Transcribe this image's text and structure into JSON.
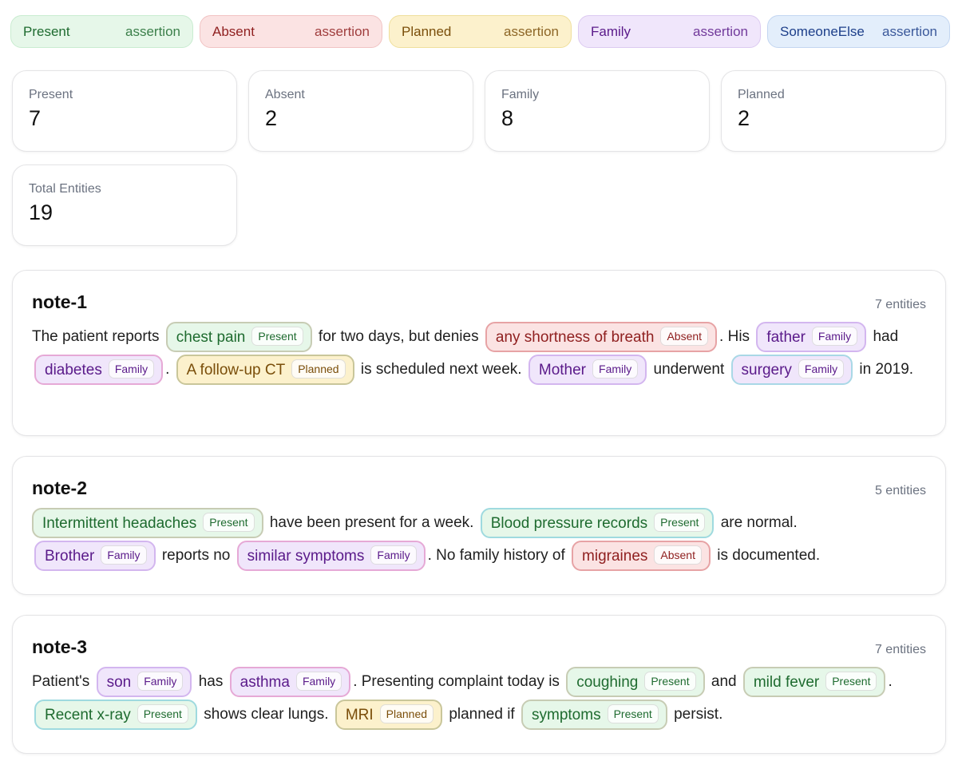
{
  "legend": [
    {
      "name": "Present",
      "tag": "assertion"
    },
    {
      "name": "Absent",
      "tag": "assertion"
    },
    {
      "name": "Planned",
      "tag": "assertion"
    },
    {
      "name": "Family",
      "tag": "assertion"
    },
    {
      "name": "SomeoneElse",
      "tag": "assertion"
    }
  ],
  "stats": {
    "present": {
      "label": "Present",
      "value": "7"
    },
    "absent": {
      "label": "Absent",
      "value": "2"
    },
    "family": {
      "label": "Family",
      "value": "8"
    },
    "planned": {
      "label": "Planned",
      "value": "2"
    },
    "total": {
      "label": "Total Entities",
      "value": "19"
    }
  },
  "notes": [
    {
      "title": "note-1",
      "count": "7 entities",
      "t": {
        "t0": "The patient reports",
        "t1": "for two days, but denies",
        "t2": ". His",
        "t3": "had",
        "t4": ".",
        "t5": "is scheduled next week.",
        "t6": "underwent",
        "t7": "in 2019."
      },
      "e": {
        "chest_pain": {
          "text": "chest pain",
          "tag": "Present"
        },
        "sob": {
          "text": "any shortness of breath",
          "tag": "Absent"
        },
        "father": {
          "text": "father",
          "tag": "Family"
        },
        "diabetes": {
          "text": "diabetes",
          "tag": "Family"
        },
        "followup": {
          "text": "A follow-up CT",
          "tag": "Planned"
        },
        "mother": {
          "text": "Mother",
          "tag": "Family"
        },
        "surgery": {
          "text": "surgery",
          "tag": "Family"
        }
      }
    },
    {
      "title": "note-2",
      "count": "5 entities",
      "t": {
        "t0": "have been present for a week.",
        "t1": "are normal.",
        "t2": "reports no",
        "t3": ". No family history of",
        "t4": "is documented."
      },
      "e": {
        "headaches": {
          "text": "Intermittent headaches",
          "tag": "Present"
        },
        "bp": {
          "text": "Blood pressure records",
          "tag": "Present"
        },
        "brother": {
          "text": "Brother",
          "tag": "Family"
        },
        "similar": {
          "text": "similar symptoms",
          "tag": "Family"
        },
        "migraines": {
          "text": "migraines",
          "tag": "Absent"
        }
      }
    },
    {
      "title": "note-3",
      "count": "7 entities",
      "t": {
        "t0": "Patient's",
        "t1": "has",
        "t2": ". Presenting complaint today is",
        "t3": "and",
        "t4": ".",
        "t5": "shows clear lungs.",
        "t6": "planned if",
        "t7": "persist."
      },
      "e": {
        "son": {
          "text": "son",
          "tag": "Family"
        },
        "asthma": {
          "text": "asthma",
          "tag": "Family"
        },
        "coughing": {
          "text": "coughing",
          "tag": "Present"
        },
        "fever": {
          "text": "mild fever",
          "tag": "Present"
        },
        "xray": {
          "text": "Recent x-ray",
          "tag": "Present"
        },
        "mri": {
          "text": "MRI",
          "tag": "Planned"
        },
        "symptoms": {
          "text": "symptoms",
          "tag": "Present"
        }
      }
    }
  ]
}
